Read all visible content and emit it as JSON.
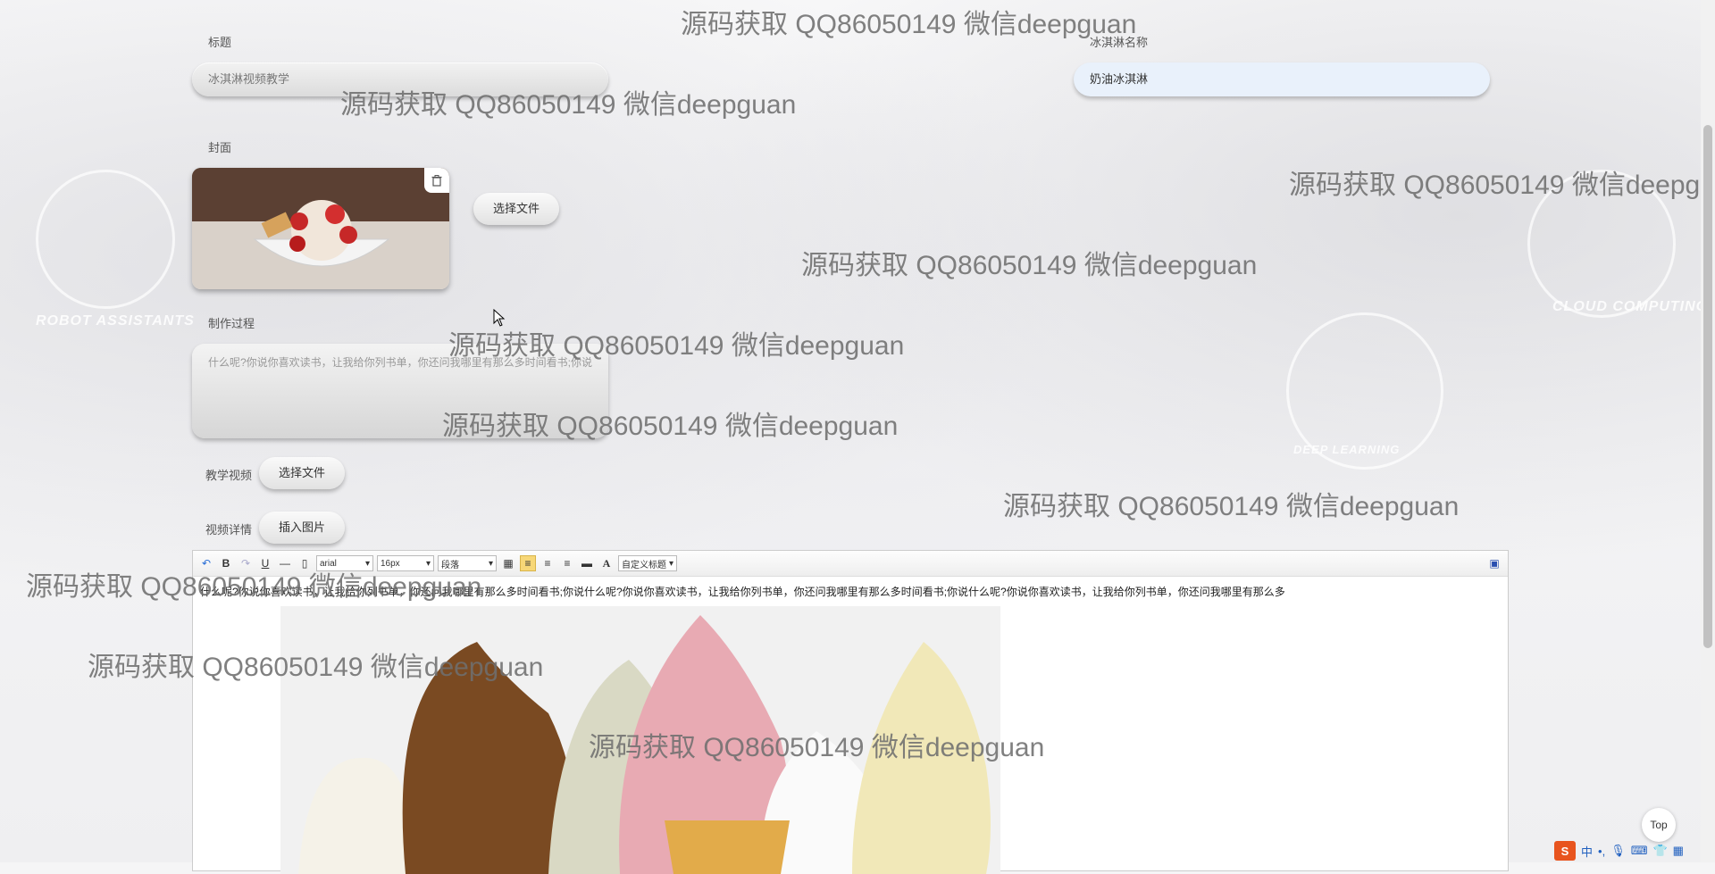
{
  "form": {
    "title_label": "标题",
    "title_value": "冰淇淋视频教学",
    "name_label": "冰淇淋名称",
    "name_value": "奶油冰淇淋",
    "cover_label": "封面",
    "cover_choose_button": "选择文件",
    "process_label": "制作过程",
    "process_value": "什么呢?你说你喜欢读书，让我给你列书单，你还问我哪里有那么多时间看书;你说",
    "video_label": "教学视频",
    "video_choose_button": "选择文件",
    "detail_label": "视频详情",
    "insert_image_button": "插入图片"
  },
  "editor": {
    "font_family": "arial",
    "font_size": "16px",
    "paragraph": "段落",
    "custom_title": "自定义标题",
    "content_text": "什么呢?你说你喜欢读书，让我给你列书单，你还问我哪里有那么多时间看书;你说什么呢?你说你喜欢读书，让我给你列书单，你还问我哪里有那么多时间看书;你说什么呢?你说你喜欢读书，让我给你列书单，你还问我哪里有那么多"
  },
  "background": {
    "robot_text": "ROBOT ASSISTANTS",
    "cloud_text": "CLOUD COMPUTING",
    "deep_text": "DEEP LEARNING"
  },
  "watermark": "源码获取 QQ86050149 微信deepguan",
  "top_button": "Top",
  "ime": {
    "lang": "中"
  }
}
